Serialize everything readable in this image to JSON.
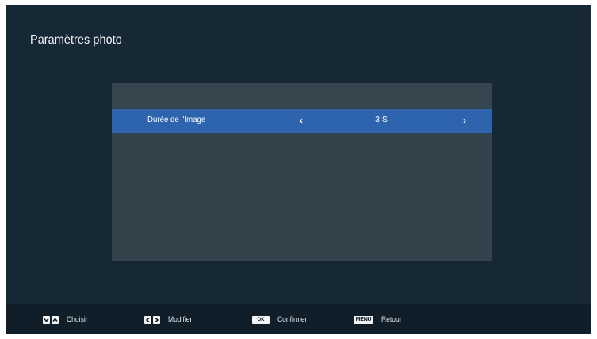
{
  "page": {
    "title": "Paramètres photo"
  },
  "settings": {
    "items": [
      {
        "label": "Durée de l'Image",
        "value": "3 S",
        "prev_icon": "‹",
        "next_icon": "›"
      }
    ]
  },
  "footer": {
    "hints": [
      {
        "keys": [
          "chevron-down-icon",
          "chevron-up-icon"
        ],
        "label": "Choisir"
      },
      {
        "keys": [
          "chevron-left-icon",
          "chevron-right-icon"
        ],
        "label": "Modifier"
      },
      {
        "key_text": "OK",
        "label": "Confirmer"
      },
      {
        "key_text": "MENU",
        "label": "Retour"
      }
    ]
  },
  "colors": {
    "background": "#162833",
    "panel": "#33434c",
    "selected_row": "#2d64ad",
    "footer": "#0f1e28"
  }
}
